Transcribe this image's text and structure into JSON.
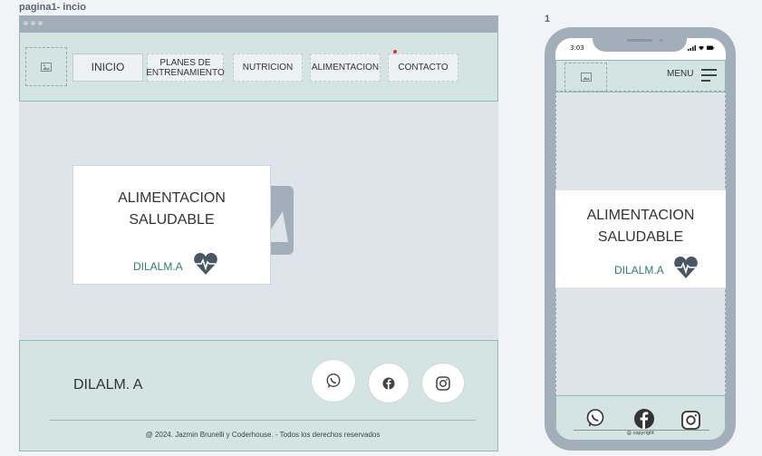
{
  "desktop": {
    "frame_label": "pagina1- incio",
    "nav": {
      "items": [
        "INICIO",
        "PLANES DE ENTRENAMIENTO",
        "NUTRICION",
        "ALIMENTACION",
        "CONTACTO"
      ],
      "planes_line1": "PLANES DE",
      "planes_line2": "ENTRENAMIENTO"
    },
    "hero": {
      "title_line1": "ALIMENTACION",
      "title_line2": "SALUDABLE",
      "brand": "DILALM.A"
    },
    "footer": {
      "brand": "DILALM. A",
      "copyright": "@ 2024.  Jazmin Brunelli  y Coderhouse. - Todos los derechos  reservados"
    }
  },
  "mobile": {
    "frame_label": "1",
    "status_time": "3:03",
    "menu_label": "MENU",
    "hero": {
      "title_line1": "ALIMENTACION",
      "title_line2": "SALUDABLE",
      "brand": "DILALM.A"
    },
    "footer": {
      "copyright": "@ copyright"
    }
  },
  "colors": {
    "accent": "#2e7d6d",
    "nav_bg": "#d3e4e2",
    "frame_gray": "#a2afbb",
    "canvas": "#dfe3ea"
  },
  "icons": [
    "image-placeholder-icon",
    "heart-pulse-icon",
    "whatsapp-icon",
    "facebook-icon",
    "instagram-icon",
    "hamburger-menu-icon"
  ]
}
